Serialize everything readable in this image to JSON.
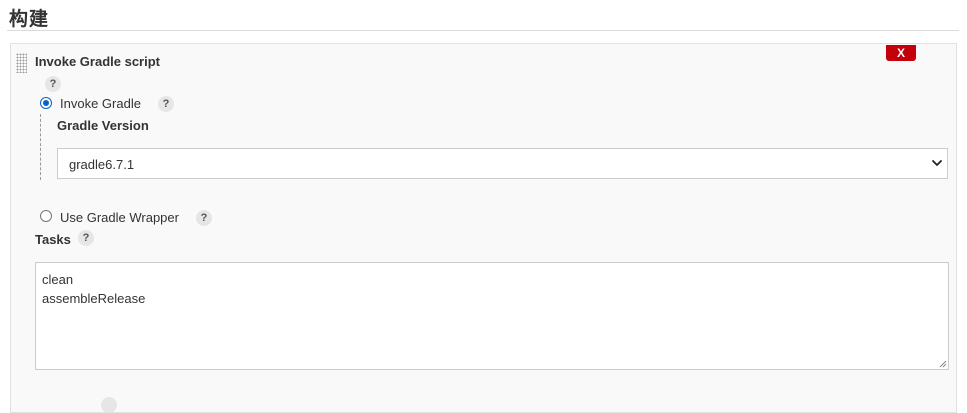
{
  "section": {
    "title": "构建"
  },
  "step": {
    "title": "Invoke Gradle script",
    "delete_label": "X",
    "help_label": "?"
  },
  "options": {
    "invoke_gradle": {
      "label": "Invoke Gradle",
      "selected": true,
      "help_label": "?"
    },
    "gradle_version": {
      "label": "Gradle Version",
      "selected_value": "gradle6.7.1"
    },
    "use_wrapper": {
      "label": "Use Gradle Wrapper",
      "selected": false,
      "help_label": "?"
    }
  },
  "tasks": {
    "label": "Tasks",
    "help_label": "?",
    "lines": [
      "clean",
      "assembleRelease"
    ]
  },
  "colors": {
    "delete_button": "#c4000a",
    "radio_accent": "#0a62c7",
    "box_background": "#f9f9f9"
  }
}
